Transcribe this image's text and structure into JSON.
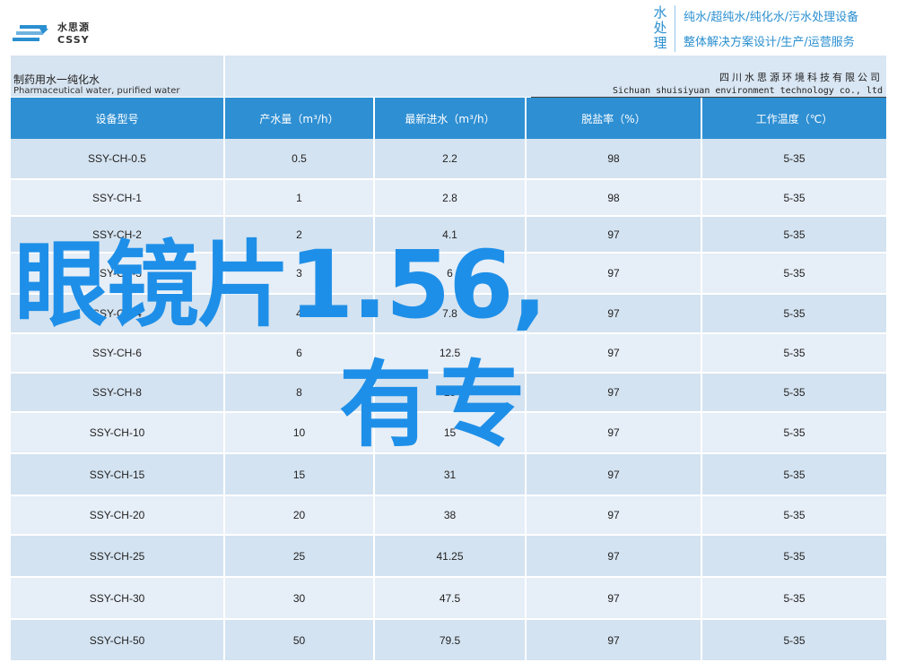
{
  "header": {
    "logo_cn": "水思源",
    "logo_en": "CSSY",
    "vertical_title": "水处理",
    "slogan_line1": "纯水/超纯水/纯化水/污水处理设备",
    "slogan_line2": "整体解决方案设计/生产/运营服务",
    "brand_color": "#2a8fd0"
  },
  "band": {
    "product_cn": "制药用水一纯化水",
    "product_en": "Pharmaceutical water, purified water",
    "company_cn": "四川水思源环境科技有限公司",
    "company_en": "Sichuan shuisiyuan environment technology co., ltd"
  },
  "table": {
    "columns": [
      "设备型号",
      "产水量（m³/h）",
      "最新进水（m³/h）",
      "脱盐率（%）",
      "工作温度（℃）"
    ],
    "rows": [
      [
        "SSY-CH-0.5",
        "0.5",
        "2.2",
        "98",
        "5-35"
      ],
      [
        "SSY-CH-1",
        "1",
        "2.8",
        "98",
        "5-35"
      ],
      [
        "SSY-CH-2",
        "2",
        "4.1",
        "97",
        "5-35"
      ],
      [
        "SSY-CH-3",
        "3",
        "6",
        "97",
        "5-35"
      ],
      [
        "SSY-CH-4",
        "4",
        "7.8",
        "97",
        "5-35"
      ],
      [
        "SSY-CH-6",
        "6",
        "12.5",
        "97",
        "5-35"
      ],
      [
        "SSY-CH-8",
        "8",
        "15",
        "97",
        "5-35"
      ],
      [
        "SSY-CH-10",
        "10",
        "15",
        "97",
        "5-35"
      ],
      [
        "SSY-CH-15",
        "15",
        "31",
        "97",
        "5-35"
      ],
      [
        "SSY-CH-20",
        "20",
        "38",
        "97",
        "5-35"
      ],
      [
        "SSY-CH-25",
        "25",
        "41.25",
        "97",
        "5-35"
      ],
      [
        "SSY-CH-30",
        "30",
        "47.5",
        "97",
        "5-35"
      ],
      [
        "SSY-CH-50",
        "50",
        "79.5",
        "97",
        "5-35"
      ]
    ]
  },
  "overlay": {
    "line1": "眼镜片1.56,",
    "line2": "有专",
    "color": "#1e8fe8"
  }
}
